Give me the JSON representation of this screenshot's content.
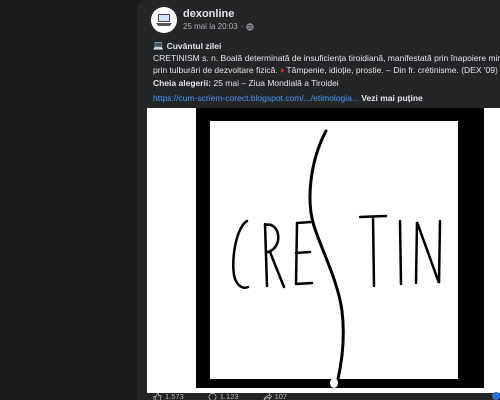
{
  "post": {
    "page_name": "dexonline",
    "timestamp": "25 mai la 20:03",
    "separator": "·",
    "heading_emoji": "💻",
    "heading": "Cuvântul zilei",
    "definition_line1": "CRETINISM s. n. Boală determinată de insuficiența tiroidiană, manifestată prin înapoiere mintală",
    "definition_line2a": "prin tulburări de dezvoltare fizică.",
    "definition_diamond": "♦",
    "definition_line2b": "Tâmpenie, idioție, prostie. – Din fr. crétinisme. (DEX '09)",
    "key_label": "Cheia alegerii:",
    "key_text": "25 mai – Ziua Mondială a Tiroidei",
    "link_text": "https://cum-scriem-corect.blogspot.com/.../etimologia...",
    "see_more": "Vezi mai puține",
    "image_text": "CRESTIN"
  },
  "reactions": {
    "likes": "1.573",
    "comments": "1.123",
    "shares": "107"
  },
  "colors": {
    "background": "#18191a",
    "card": "#242526",
    "link": "#4599ff",
    "diamond": "#e02424"
  }
}
